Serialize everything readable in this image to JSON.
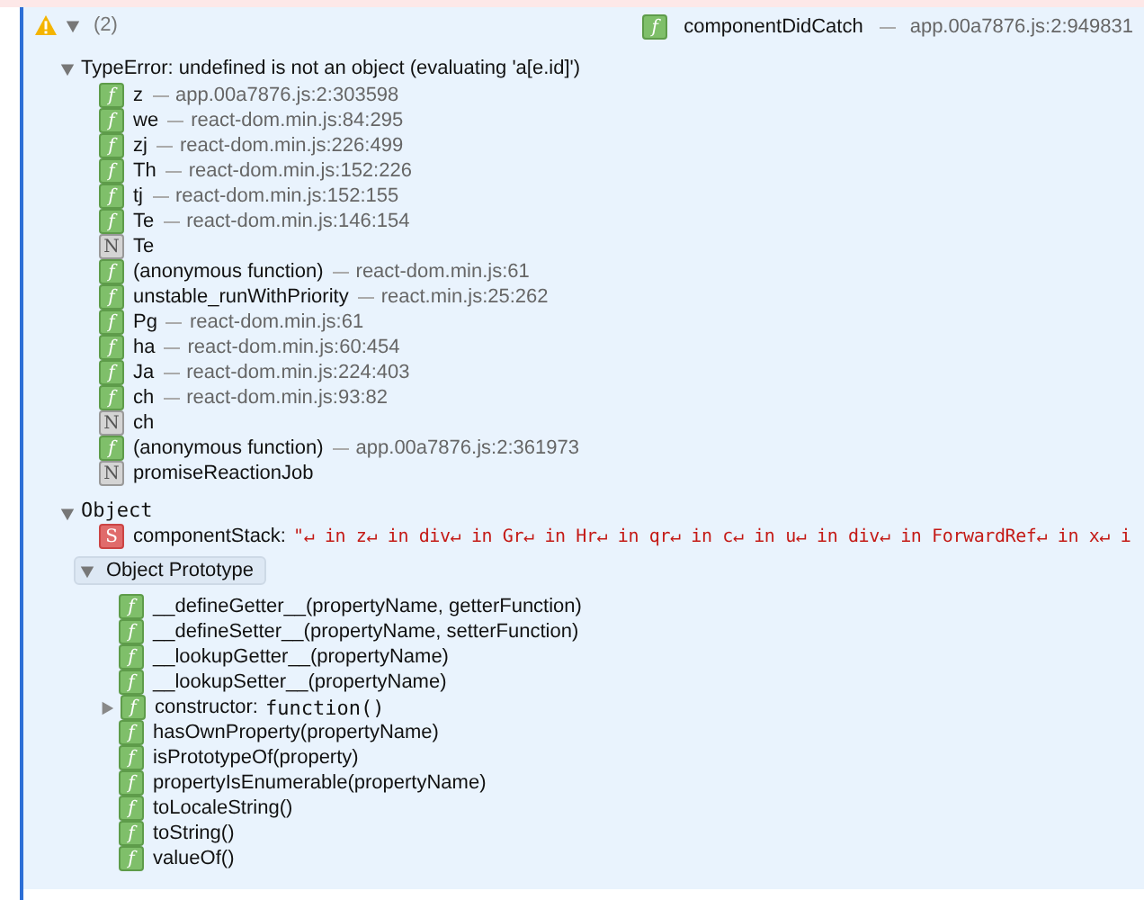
{
  "header": {
    "count": "(2)",
    "expanded": true,
    "function": {
      "badge": "f",
      "kind": "function",
      "name": "componentDidCatch",
      "location": "app.00a7876.js:2:949831"
    }
  },
  "error": {
    "message": "TypeError: undefined is not an object (evaluating 'a[e.id]')",
    "expanded": true,
    "frames": [
      {
        "badge": "f",
        "kind": "function",
        "name": "z",
        "location": "app.00a7876.js:2:303598"
      },
      {
        "badge": "f",
        "kind": "function",
        "name": "we",
        "location": "react-dom.min.js:84:295"
      },
      {
        "badge": "f",
        "kind": "function",
        "name": "zj",
        "location": "react-dom.min.js:226:499"
      },
      {
        "badge": "f",
        "kind": "function",
        "name": "Th",
        "location": "react-dom.min.js:152:226"
      },
      {
        "badge": "f",
        "kind": "function",
        "name": "tj",
        "location": "react-dom.min.js:152:155"
      },
      {
        "badge": "f",
        "kind": "function",
        "name": "Te",
        "location": "react-dom.min.js:146:154"
      },
      {
        "badge": "N",
        "kind": "native",
        "name": "Te"
      },
      {
        "badge": "f",
        "kind": "function",
        "name": "(anonymous function)",
        "location": "react-dom.min.js:61"
      },
      {
        "badge": "f",
        "kind": "function",
        "name": "unstable_runWithPriority",
        "location": "react.min.js:25:262"
      },
      {
        "badge": "f",
        "kind": "function",
        "name": "Pg",
        "location": "react-dom.min.js:61"
      },
      {
        "badge": "f",
        "kind": "function",
        "name": "ha",
        "location": "react-dom.min.js:60:454"
      },
      {
        "badge": "f",
        "kind": "function",
        "name": "Ja",
        "location": "react-dom.min.js:224:403"
      },
      {
        "badge": "f",
        "kind": "function",
        "name": "ch",
        "location": "react-dom.min.js:93:82"
      },
      {
        "badge": "N",
        "kind": "native",
        "name": "ch"
      },
      {
        "badge": "f",
        "kind": "function",
        "name": "(anonymous function)",
        "location": "app.00a7876.js:2:361973"
      },
      {
        "badge": "N",
        "kind": "native",
        "name": "promiseReactionJob"
      }
    ]
  },
  "object": {
    "label": "Object",
    "expanded": true,
    "properties": [
      {
        "badge": "S",
        "kind": "string",
        "key": "componentStack:",
        "value": "\"↵ in z↵ in div↵ in Gr↵ in Hr↵ in qr↵ in c↵ in u↵ in div↵ in ForwardRef↵ in x↵ i"
      }
    ],
    "prototype": {
      "label": "Object Prototype",
      "expanded": true,
      "methods": [
        {
          "badge": "f",
          "name": "__defineGetter__(propertyName, getterFunction)",
          "expandable": false
        },
        {
          "badge": "f",
          "name": "__defineSetter__(propertyName, setterFunction)",
          "expandable": false
        },
        {
          "badge": "f",
          "name": "__lookupGetter__(propertyName)",
          "expandable": false
        },
        {
          "badge": "f",
          "name": "__lookupSetter__(propertyName)",
          "expandable": false
        },
        {
          "badge": "f",
          "name": "constructor:",
          "value": "function()",
          "expandable": true
        },
        {
          "badge": "f",
          "name": "hasOwnProperty(propertyName)",
          "expandable": false
        },
        {
          "badge": "f",
          "name": "isPrototypeOf(property)",
          "expandable": false
        },
        {
          "badge": "f",
          "name": "propertyIsEnumerable(propertyName)",
          "expandable": false
        },
        {
          "badge": "f",
          "name": "toLocaleString()",
          "expandable": false
        },
        {
          "badge": "f",
          "name": "toString()",
          "expandable": false
        },
        {
          "badge": "f",
          "name": "valueOf()",
          "expandable": false
        }
      ]
    }
  }
}
